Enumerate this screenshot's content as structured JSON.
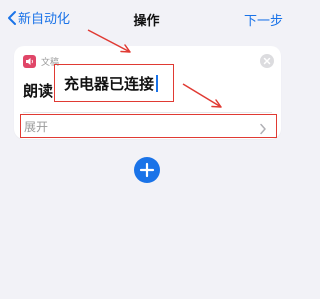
{
  "nav": {
    "back_label": "新自动化",
    "title": "操作",
    "next_label": "下一步"
  },
  "action_card": {
    "category_label": "文稿",
    "category_icon": "speaker-icon",
    "verb": "朗读",
    "text_value": "充电器已连接",
    "expand_label": "展开"
  },
  "colors": {
    "accent": "#1a73e8",
    "highlight": "#e03a33",
    "category_icon_bg": "#e04668"
  }
}
